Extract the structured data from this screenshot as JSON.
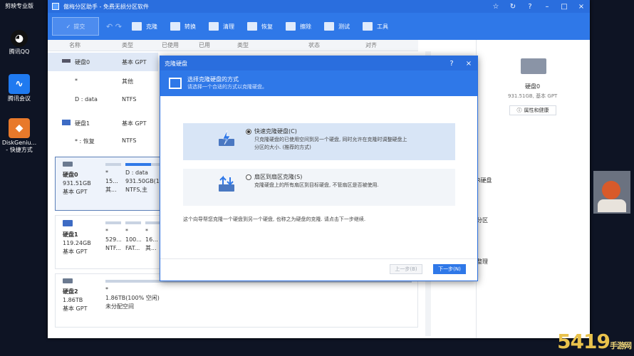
{
  "desktop": {
    "icons": [
      {
        "label": "剪映专业版",
        "color": "#222"
      },
      {
        "label": "腾讯QQ",
        "color": "#111"
      },
      {
        "label": "腾讯会议",
        "color": "#1f7af0"
      },
      {
        "label": "DiskGeniu... - 快捷方式",
        "color": "#e8792b"
      }
    ]
  },
  "app": {
    "title": "傲梅分区助手 - 免费无损分区软件",
    "window_controls": [
      "☆",
      "↻",
      "?",
      "–",
      "□",
      "×"
    ],
    "toolbar": {
      "submit": "提交",
      "undo": "↶ ↷",
      "items": [
        "克隆",
        "转换",
        "清理",
        "恢复",
        "擦除",
        "测试",
        "工具"
      ]
    },
    "columns": [
      "名称",
      "类型",
      "已使用",
      "已用",
      "类型",
      "状态",
      "对齐"
    ],
    "list": [
      {
        "name": "硬盘0",
        "type": "基本 GPT"
      },
      {
        "name": "*",
        "type": "其他"
      },
      {
        "name": "D : data",
        "type": "NTFS"
      },
      {
        "name": "硬盘1",
        "type": "基本 GPT"
      },
      {
        "name": "* : 恢复",
        "type": "NTFS"
      }
    ],
    "disks": [
      {
        "name": "硬盘0",
        "size": "931.51GB",
        "kind": "基本 GPT",
        "parts": [
          {
            "l1": "*",
            "l2": "15...",
            "l3": "其..."
          },
          {
            "l1": "D : data",
            "l2": "931.50GB(14...",
            "l3": "NTFS,主"
          }
        ]
      },
      {
        "name": "硬盘1",
        "size": "119.24GB",
        "kind": "基本 GPT",
        "parts": [
          {
            "l1": "*",
            "l2": "529...",
            "l3": "NTF..."
          },
          {
            "l1": "*",
            "l2": "100...",
            "l3": "FAT..."
          },
          {
            "l1": "*",
            "l2": "16...",
            "l3": "其..."
          }
        ]
      },
      {
        "name": "硬盘2",
        "size": "1.86TB",
        "kind": "基本 GPT",
        "parts": [
          {
            "l1": "*",
            "l2": "1.86TB(100% 空闲)",
            "l3": "未分配空间"
          }
        ]
      }
    ],
    "right_panel": {
      "disk_name": "硬盘0",
      "disk_info": "931.51GB, 基本 GPT",
      "prop_button": "属性和健康",
      "peek": [
        "R硬盘",
        "分区",
        "整理"
      ]
    }
  },
  "dialog": {
    "title": "克隆硬盘",
    "help": "?",
    "close": "×",
    "banner_title": "选择克隆硬盘的方式",
    "banner_sub": "请选择一个合适的方式以克隆硬盘。",
    "options": [
      {
        "title": "快速克隆硬盘(C)",
        "desc": "只克隆硬盘的已使用空间到另一个硬盘, 同时允许在克隆时调整硬盘上分区的大小. (推荐的方式)",
        "selected": true
      },
      {
        "title": "扇区到扇区克隆(S)",
        "desc": "克隆硬盘上的所有扇区到目标硬盘, 不管扇区是否被使用.",
        "selected": false
      }
    ],
    "note": "这个向导帮您克隆一个硬盘到另一个硬盘, 也称之为硬盘的克隆. 请点击下一步继续.",
    "prev": "上一步(B)",
    "next": "下一步(N)"
  },
  "watermark": {
    "main": "5419",
    "sub": "手游网"
  }
}
